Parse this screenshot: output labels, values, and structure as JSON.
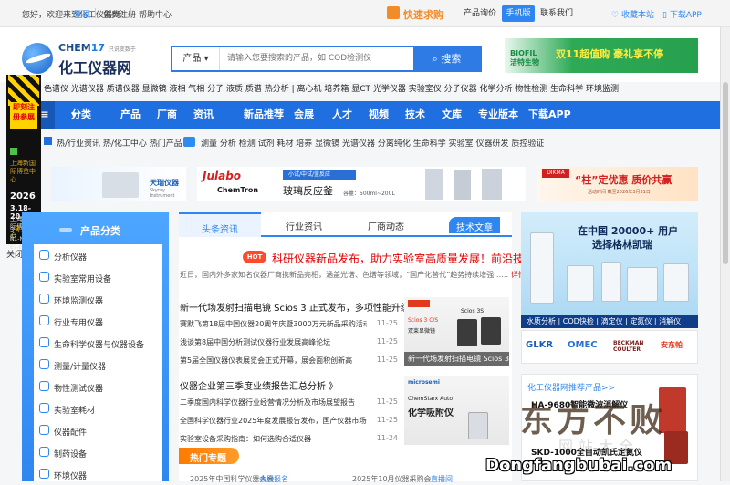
{
  "topbar": {
    "welcome": "您好，欢迎来到化工仪器网！",
    "login": "登录",
    "register": "免费注册",
    "help": "帮助中心",
    "quick_buy": "快速求购",
    "links": [
      "产品询价",
      "手机版",
      "联系我们"
    ],
    "active_link": "手机版",
    "favorite": "收藏本站",
    "app": "下载APP"
  },
  "logo": {
    "brand": "CHEM",
    "brand_num": "17",
    "slogan": "只说变数于",
    "name": "化工仪器网"
  },
  "search": {
    "category": "产品",
    "placeholder": "请输入您要搜索的产品，如 COD检测仪",
    "button": "搜索"
  },
  "top_ad": {
    "brand": "BIOFIL",
    "brand_cn": "洁特生物",
    "slogan": "双11超值购 豪礼享不停"
  },
  "category_line": "色谱仪 光谱仪器 质谱仪器 显微镜 液相 气相 分子 液质 质谱 热分析 | 离心机 培养箱 显CT 光学仪器 实验室仪 分子仪器 化学分析 物性检测 生命科学 环境监测",
  "main_nav": [
    "分类",
    "产品",
    "厂商",
    "资讯",
    "新品推荐",
    "会展",
    "人才",
    "视频",
    "技术",
    "文库",
    "专业版本",
    "下载APP"
  ],
  "hot_line": {
    "left": "热/行业资讯 热/化工中心 热门产品",
    "right": "测量 分析 检测 试剂 耗材 培养 显微镜 光谱仪器 分离纯化 生命科学 实验室 仪器研发 质控验证"
  },
  "banners": {
    "b1_brand": "天瑞仪器",
    "b1_sub": "Skyray Instrument",
    "b2_brand": "Julabo",
    "b2_brand2": "ChemTron",
    "b2_title": "玻璃反应釜",
    "b2_sub": "容量：500ml~200L",
    "b2_tag": "小试/中试/釜反应",
    "b3_brand": "DIKMA",
    "b3_title": "“柱”定优惠 质价共赢",
    "b3_sub": "活动时间 截至2026年3月31日"
  },
  "side_ad": {
    "badge": "即刻注册参展",
    "line1": "上海新国际博览中心",
    "year": "2026",
    "dates": "3.18-20",
    "venue": "上海新国际博览中心",
    "hall": "3号入口门",
    "booth": "N1-N5, E7-E8馆"
  },
  "close_ad": "关闭",
  "left_panel": {
    "title": "产品分类",
    "items": [
      "分析仪器",
      "实验室常用设备",
      "环境监测仪器",
      "行业专用仪器",
      "生命科学仪器与仪器设备",
      "测量/计量仪器",
      "物性测试仪器",
      "实验室耗材",
      "仪器配件",
      "制药设备",
      "环境仪器"
    ]
  },
  "center": {
    "tabs": [
      "头条资讯",
      "行业资讯",
      "厂商动态",
      "技术文章"
    ],
    "active_tab": "头条资讯",
    "hot_badge": "HOT",
    "headline": "科研仪器新品发布，助力实验室高质量发展！前沿技术",
    "intro": "近日，国内外多家知名仪器厂商携新品亮相，涵盖光谱、色谱等领域，“国产化替代”趋势持续增强……",
    "more": "详情>>",
    "groups": [
      {
        "title": "新一代场发射扫描电镜 Scios 3 正式发布，多项性能升级",
        "rows": [
          {
            "text": "赛默飞第18届中国仪器20周年庆暨3000万元新品采购活动启动仪式",
            "date": "11-25"
          },
          {
            "text": "浅谈第8届中国分析测试仪器行业发展高峰论坛",
            "date": "11-25"
          },
          {
            "text": "第5届全国仪器仪表展览会正式开幕，展会面积创新高",
            "date": "11-25"
          }
        ],
        "image_caption": "新一代场发射扫描电镜 Scios 3 正式",
        "image_label": "Scios 3 C/S",
        "image_label2": "Scios 3S",
        "image_sub": "双束显微镜"
      },
      {
        "title": "仪器企业第三季度业绩报告汇总分析 》",
        "rows": [
          {
            "text": "二季度国内科学仪器行业经营情况分析及市场展望报告",
            "date": "11-25"
          },
          {
            "text": "全国科学仪器行业2025年度发展报告发布，国产仪器市场份额持续提升",
            "date": "11-25"
          },
          {
            "text": "实验室设备采购指南：如何选购合适仪器",
            "date": "11-24"
          }
        ],
        "image_brand": "microsemi",
        "image_title": "ChemStarx Auto",
        "image_sub": "化学吸附仪"
      }
    ],
    "hot_spec": "热门专题",
    "footer_items": [
      "2025年中国科学仪器大会",
      "会展报名",
      "2025年10月仪器采购会",
      "直播间"
    ]
  },
  "right_ad": {
    "headline1": "在中国 20000+ 用户",
    "headline2": "选择格林凯瑞",
    "strip": "水质分析 | COD快检 | 滴定仪 | 定氮仪 | 消解仪"
  },
  "partner_logos": [
    "GLKR",
    "OMEC",
    "BECKMAN COULTER",
    "安东帕"
  ],
  "right2": {
    "link": "化工仪器网推荐产品>>",
    "p1": "HA-9680智能微波消解仪",
    "p2": "SKD-1000全自动凯氏定氮仪"
  },
  "watermark": {
    "big": "东方不败",
    "mid": "网站大全",
    "url": "Dongfangbubai.com"
  }
}
